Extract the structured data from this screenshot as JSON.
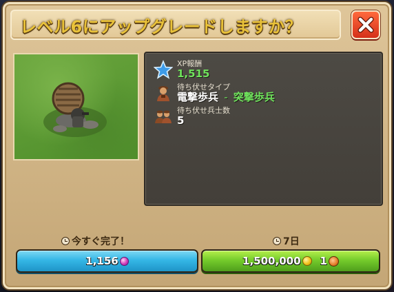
{
  "dialog": {
    "title": "レベル6にアップグレードしますか？",
    "close_icon": "close-x-icon"
  },
  "stats": {
    "xp": {
      "label": "XP報酬",
      "value": "1,515",
      "icon": "star-icon"
    },
    "ambush_type": {
      "label": "待ち伏せタイプ",
      "current": "電撃歩兵",
      "separator": "-",
      "next": "突撃歩兵",
      "icon": "soldier-icon"
    },
    "ambush_count": {
      "label": "待ち伏せ兵士数",
      "value": "5",
      "icon": "soldiers-group-icon"
    }
  },
  "actions": {
    "instant": {
      "time_label": "今すぐ完了！",
      "cost": "1,156",
      "currency_icon": "diamond-icon"
    },
    "upgrade": {
      "time_label": "7日",
      "gold_cost": "1,500,000",
      "gold_icon": "gold-coin-icon",
      "token_cost": "1",
      "token_icon": "token-icon"
    }
  },
  "colors": {
    "title": "#e9c23a",
    "green_text": "#6fe35c",
    "instant_button": "#35b7e6",
    "upgrade_button": "#75cc2c",
    "close_button": "#d5301a"
  }
}
